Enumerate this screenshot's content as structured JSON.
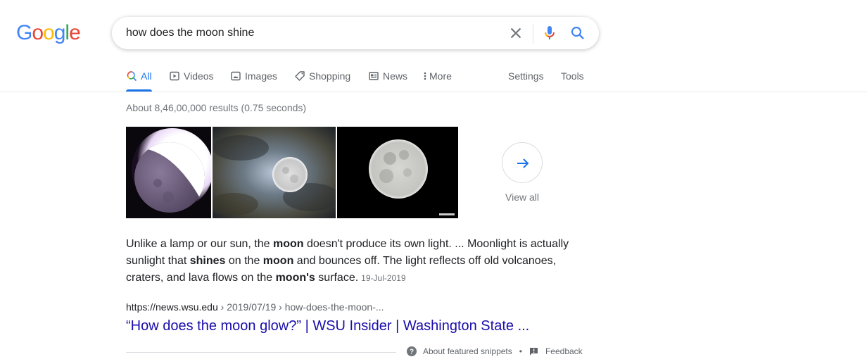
{
  "logo": {
    "text": "Google",
    "letters": [
      "G",
      "o",
      "o",
      "g",
      "l",
      "e"
    ],
    "colors": [
      "#4285f4",
      "#ea4335",
      "#fbbc05",
      "#4285f4",
      "#34a853",
      "#ea4335"
    ]
  },
  "search": {
    "query": "how does the moon shine",
    "placeholder": ""
  },
  "tabs": [
    {
      "label": "All",
      "icon": "search-icon",
      "active": true
    },
    {
      "label": "Videos",
      "icon": "play-icon",
      "active": false
    },
    {
      "label": "Images",
      "icon": "image-icon",
      "active": false
    },
    {
      "label": "Shopping",
      "icon": "tag-icon",
      "active": false
    },
    {
      "label": "News",
      "icon": "newspaper-icon",
      "active": false
    },
    {
      "label": "More",
      "icon": "more-vert-icon",
      "active": false
    }
  ],
  "tools": {
    "settings": "Settings",
    "tools": "Tools"
  },
  "result_stats": "About 8,46,00,000 results (0.75 seconds)",
  "images": [
    {
      "alt": "Partially lit moon with bright glow"
    },
    {
      "alt": "Full moon behind clouds"
    },
    {
      "alt": "Full moon on black sky"
    }
  ],
  "view_all": {
    "label": "View all",
    "icon": "arrow-right-icon"
  },
  "snippet": {
    "parts": [
      {
        "text": "Unlike a lamp or our sun, the ",
        "bold": false
      },
      {
        "text": "moon",
        "bold": true
      },
      {
        "text": " doesn't produce its own light. ... Moonlight is actually sunlight that ",
        "bold": false
      },
      {
        "text": "shines",
        "bold": true
      },
      {
        "text": " on the ",
        "bold": false
      },
      {
        "text": "moon",
        "bold": true
      },
      {
        "text": " and bounces off. The light reflects off old volcanoes, craters, and lava flows on the ",
        "bold": false
      },
      {
        "text": "moon's",
        "bold": true
      },
      {
        "text": " surface.",
        "bold": false
      }
    ],
    "date": "19-Jul-2019"
  },
  "result": {
    "url_host": "https://news.wsu.edu",
    "url_path": " › 2019/07/19 › how-does-the-moon-...",
    "title": "“How does the moon glow?” | WSU Insider | Washington State ..."
  },
  "footer": {
    "about": "About featured snippets",
    "separator": "•",
    "feedback": "Feedback"
  },
  "colors": {
    "link": "#1a0dab",
    "accent": "#1a73e8",
    "muted": "#70757a"
  }
}
